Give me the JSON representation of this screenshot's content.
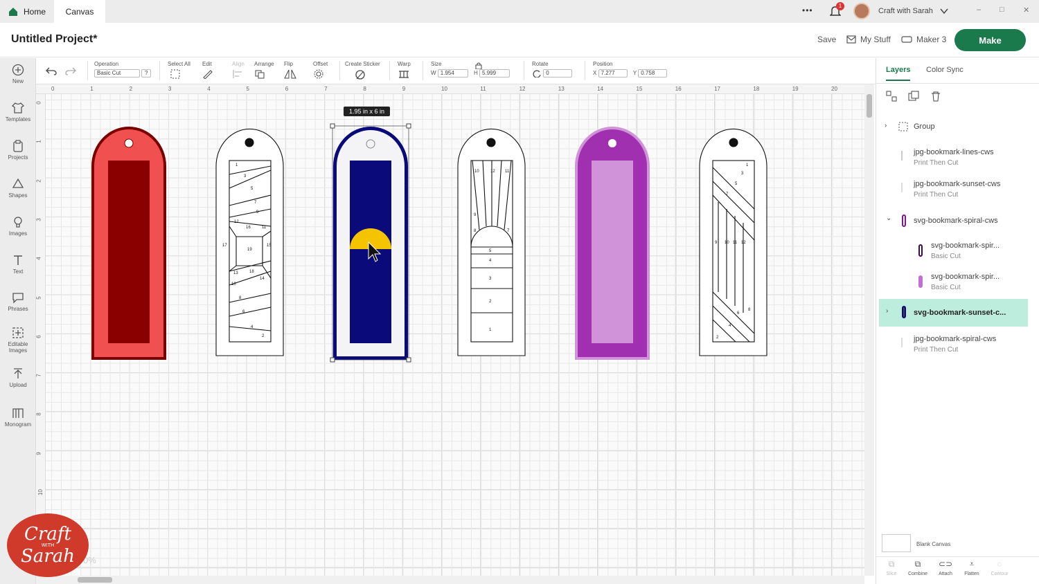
{
  "tabs": {
    "home": "Home",
    "canvas": "Canvas"
  },
  "topbar": {
    "more": "•••",
    "notif_count": "1",
    "user": "Craft with Sarah",
    "win_min": "–",
    "win_max": "□",
    "win_close": "✕"
  },
  "header": {
    "title": "Untitled Project*",
    "save": "Save",
    "my_stuff": "My Stuff",
    "machine": "Maker 3",
    "make": "Make"
  },
  "left_tools": [
    "New",
    "Templates",
    "Projects",
    "Shapes",
    "Images",
    "Text",
    "Phrases",
    "Editable Images",
    "Upload",
    "Monogram"
  ],
  "toolbar": {
    "operation_label": "Operation",
    "operation_value": "Basic Cut",
    "help": "?",
    "select_all": "Select All",
    "edit": "Edit",
    "align": "Align",
    "arrange": "Arrange",
    "flip": "Flip",
    "offset": "Offset",
    "create_sticker": "Create Sticker",
    "warp": "Warp",
    "size": "Size",
    "w_label": "W",
    "w_value": "1.954",
    "h_label": "H",
    "h_value": "5.999",
    "rotate": "Rotate",
    "rotate_value": "0",
    "position": "Position",
    "x_label": "X",
    "x_value": "7.277",
    "y_label": "Y",
    "y_value": "0.758"
  },
  "ruler": {
    "top": [
      "0",
      "1",
      "2",
      "3",
      "4",
      "5",
      "6",
      "7",
      "8",
      "9",
      "10",
      "11",
      "12",
      "13",
      "14",
      "15",
      "16",
      "17",
      "18",
      "19",
      "20"
    ],
    "left": [
      "0",
      "1",
      "2",
      "3",
      "4",
      "5",
      "6",
      "7",
      "8",
      "9",
      "10"
    ]
  },
  "canvas": {
    "size_tooltip": "1.95  in x 6  in",
    "zoom": "0%",
    "lines_numbers": [
      "1",
      "3",
      "5",
      "7",
      "9",
      "12",
      "16",
      "11",
      "17",
      "19",
      "15",
      "13",
      "18",
      "10",
      "14",
      "8",
      "6",
      "4",
      "2"
    ],
    "sunset_numbers": [
      "10",
      "12",
      "11",
      "9",
      "8",
      "7",
      "5",
      "4",
      "3",
      "2",
      "1"
    ],
    "spiral_numbers": [
      "1",
      "3",
      "5",
      "7",
      "9",
      "10",
      "11",
      "12",
      "8",
      "6",
      "4",
      "2"
    ]
  },
  "panel": {
    "tab_layers": "Layers",
    "tab_colorsync": "Color Sync",
    "layers": [
      {
        "name": "Group",
        "sub": ""
      },
      {
        "name": "jpg-bookmark-lines-cws",
        "sub": "Print Then Cut"
      },
      {
        "name": "jpg-bookmark-sunset-cws",
        "sub": "Print Then Cut"
      },
      {
        "name": "svg-bookmark-spiral-cws",
        "sub": ""
      },
      {
        "name": "svg-bookmark-spir...",
        "sub": "Basic Cut"
      },
      {
        "name": "svg-bookmark-spir...",
        "sub": "Basic Cut"
      },
      {
        "name": "svg-bookmark-sunset-c...",
        "sub": ""
      },
      {
        "name": "jpg-bookmark-spiral-cws",
        "sub": "Print Then Cut"
      }
    ],
    "blank_canvas": "Blank Canvas",
    "bottom": [
      "Slice",
      "Combine",
      "Attach",
      "Flatten",
      "Contour"
    ]
  },
  "logo": {
    "line1": "Craft",
    "with": "WITH",
    "line2": "Sarah"
  },
  "colors": {
    "accent": "#1a7a4c",
    "red_outer": "#7a0000",
    "red_mid": "#f05050",
    "navy": "#0a0a7a",
    "yellow": "#f5c400",
    "purple": "#a030b0",
    "lilac": "#d092d8"
  }
}
